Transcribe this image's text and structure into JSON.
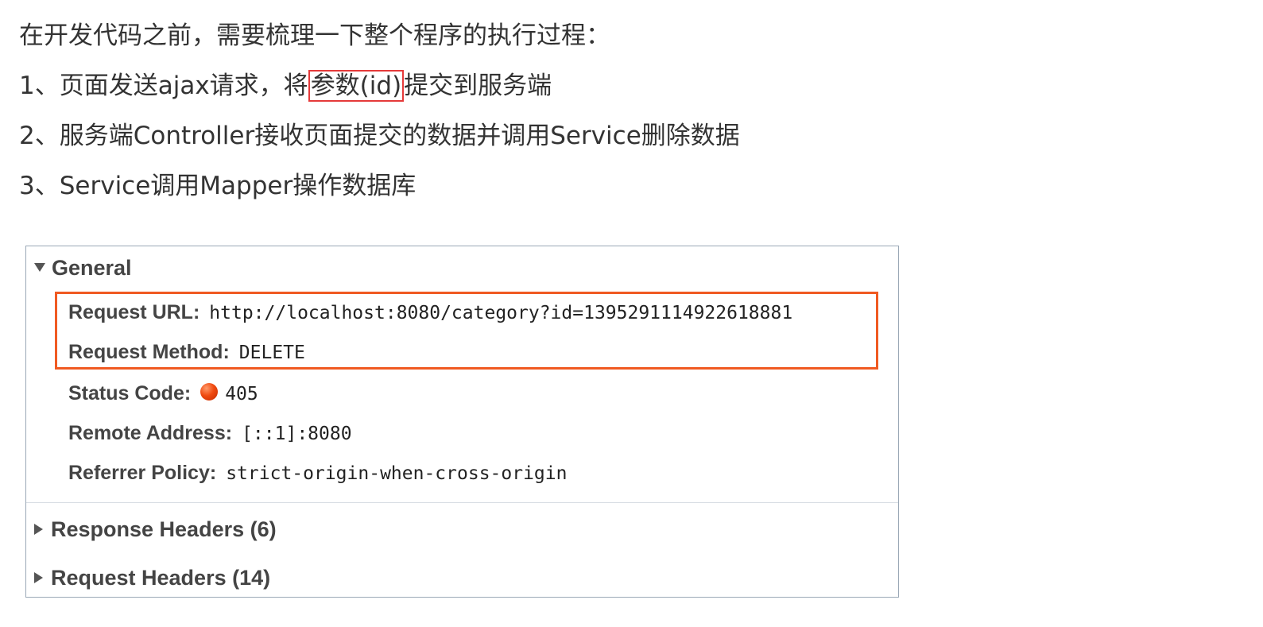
{
  "intro": {
    "title": "在开发代码之前，需要梳理一下整个程序的执行过程：",
    "step1_before": "1、页面发送ajax请求，将",
    "step1_highlight": "参数(id)",
    "step1_after": "提交到服务端",
    "step2": "2、服务端Controller接收页面提交的数据并调用Service删除数据",
    "step3": "3、Service调用Mapper操作数据库"
  },
  "devtools": {
    "general": {
      "label": "General",
      "request_url_label": "Request URL:",
      "request_url": "http://localhost:8080/category?id=1395291114922618881",
      "request_method_label": "Request Method:",
      "request_method": "DELETE",
      "status_code_label": "Status Code:",
      "status_code": "405",
      "remote_address_label": "Remote Address:",
      "remote_address": "[::1]:8080",
      "referrer_policy_label": "Referrer Policy:",
      "referrer_policy": "strict-origin-when-cross-origin"
    },
    "response_headers_label": "Response Headers (6)",
    "request_headers_label": "Request Headers (14)"
  },
  "colors": {
    "highlight_red": "#e53a3a",
    "highlight_orange": "#f05a22",
    "status_error": "#f04a10"
  }
}
